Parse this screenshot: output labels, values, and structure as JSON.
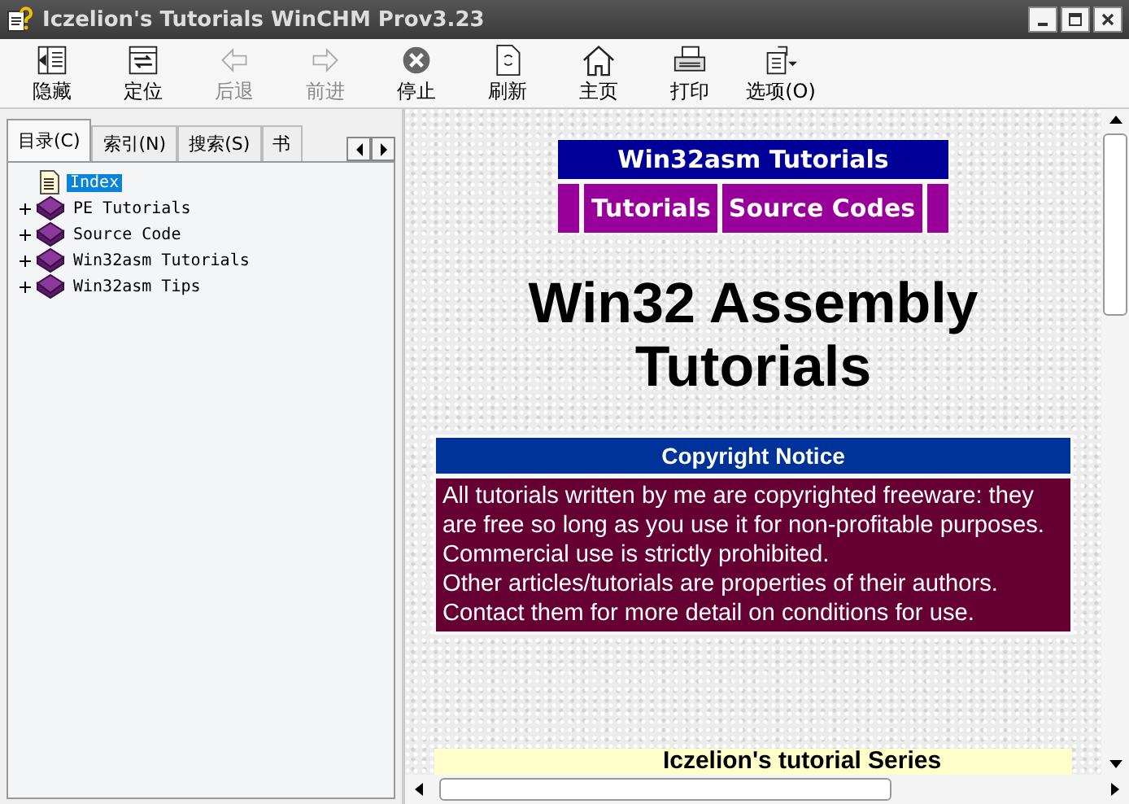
{
  "window": {
    "title": "Iczelion's Tutorials WinCHM Prov3.23"
  },
  "toolbar": [
    {
      "kind": "hide",
      "label": "隐藏",
      "disabled": false
    },
    {
      "kind": "locate",
      "label": "定位",
      "disabled": false
    },
    {
      "kind": "back",
      "label": "后退",
      "disabled": true
    },
    {
      "kind": "forward",
      "label": "前进",
      "disabled": true
    },
    {
      "kind": "stop",
      "label": "停止",
      "disabled": false
    },
    {
      "kind": "refresh",
      "label": "刷新",
      "disabled": false
    },
    {
      "kind": "home",
      "label": "主页",
      "disabled": false
    },
    {
      "kind": "print",
      "label": "打印",
      "disabled": false
    },
    {
      "kind": "options",
      "label": "选项(O)",
      "disabled": false
    }
  ],
  "tabs": [
    {
      "label": "目录(C)",
      "selected": true
    },
    {
      "label": "索引(N)",
      "selected": false
    },
    {
      "label": "搜索(S)",
      "selected": false
    },
    {
      "label": "书",
      "selected": false
    }
  ],
  "tree": [
    {
      "kind": "page",
      "label": "Index",
      "selected": true
    },
    {
      "kind": "book",
      "label": "PE Tutorials",
      "selected": false,
      "expanded": false
    },
    {
      "kind": "book",
      "label": "Source Code",
      "selected": false,
      "expanded": false
    },
    {
      "kind": "book",
      "label": "Win32asm Tutorials",
      "selected": false,
      "expanded": false
    },
    {
      "kind": "book",
      "label": "Win32asm Tips",
      "selected": false,
      "expanded": false
    }
  ],
  "page": {
    "nav_title": "Win32asm Tutorials",
    "nav_links": [
      "Tutorials",
      "Source Codes"
    ],
    "heading": "Win32 Assembly Tutorials",
    "notice_title": "Copyright Notice",
    "notice_lines": [
      "All tutorials written by me are copyrighted freeware: they are free so long as you use it for non-profitable purposes. Commercial use is strictly prohibited.",
      "Other articles/tutorials are properties of their authors. Contact them for more detail on conditions for use."
    ],
    "series_title": "Iczelion's tutorial Series"
  }
}
